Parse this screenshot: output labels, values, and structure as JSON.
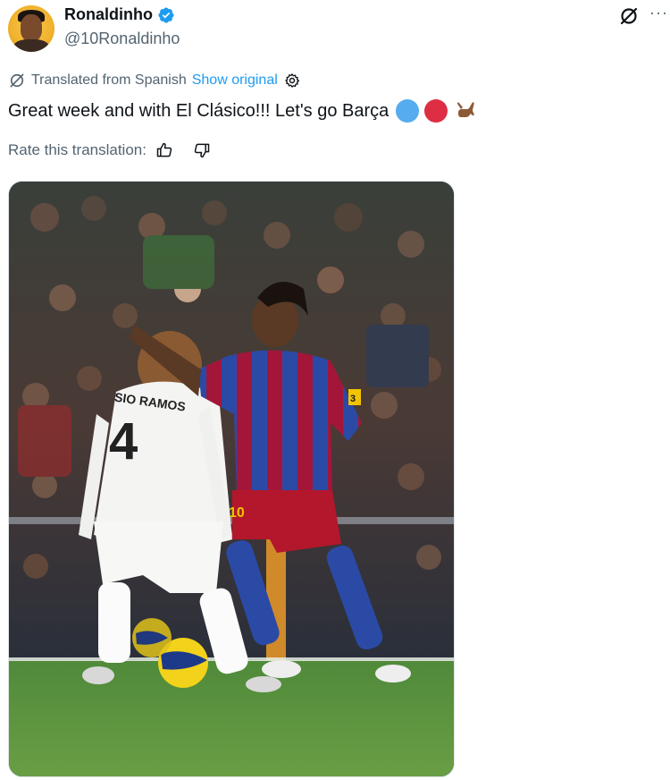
{
  "user": {
    "name": "Ronaldinho",
    "handle": "@10Ronaldinho"
  },
  "translation": {
    "label": "Translated from Spanish",
    "show_original": "Show original"
  },
  "tweet": {
    "text": "Great week and with El Clásico!!! Let's go Barça"
  },
  "rate": {
    "label": "Rate this translation:"
  },
  "photo": {
    "shirt_name": "SIO RAMOS",
    "shirt_number": "4",
    "captain_badge": "3",
    "short_number": "10"
  },
  "colors": {
    "accent": "#1d9bf0",
    "emoji_blue": "#55acee",
    "emoji_red": "#dd2e44",
    "barca_blue": "#2b4aa6",
    "barca_red": "#a3163a"
  }
}
